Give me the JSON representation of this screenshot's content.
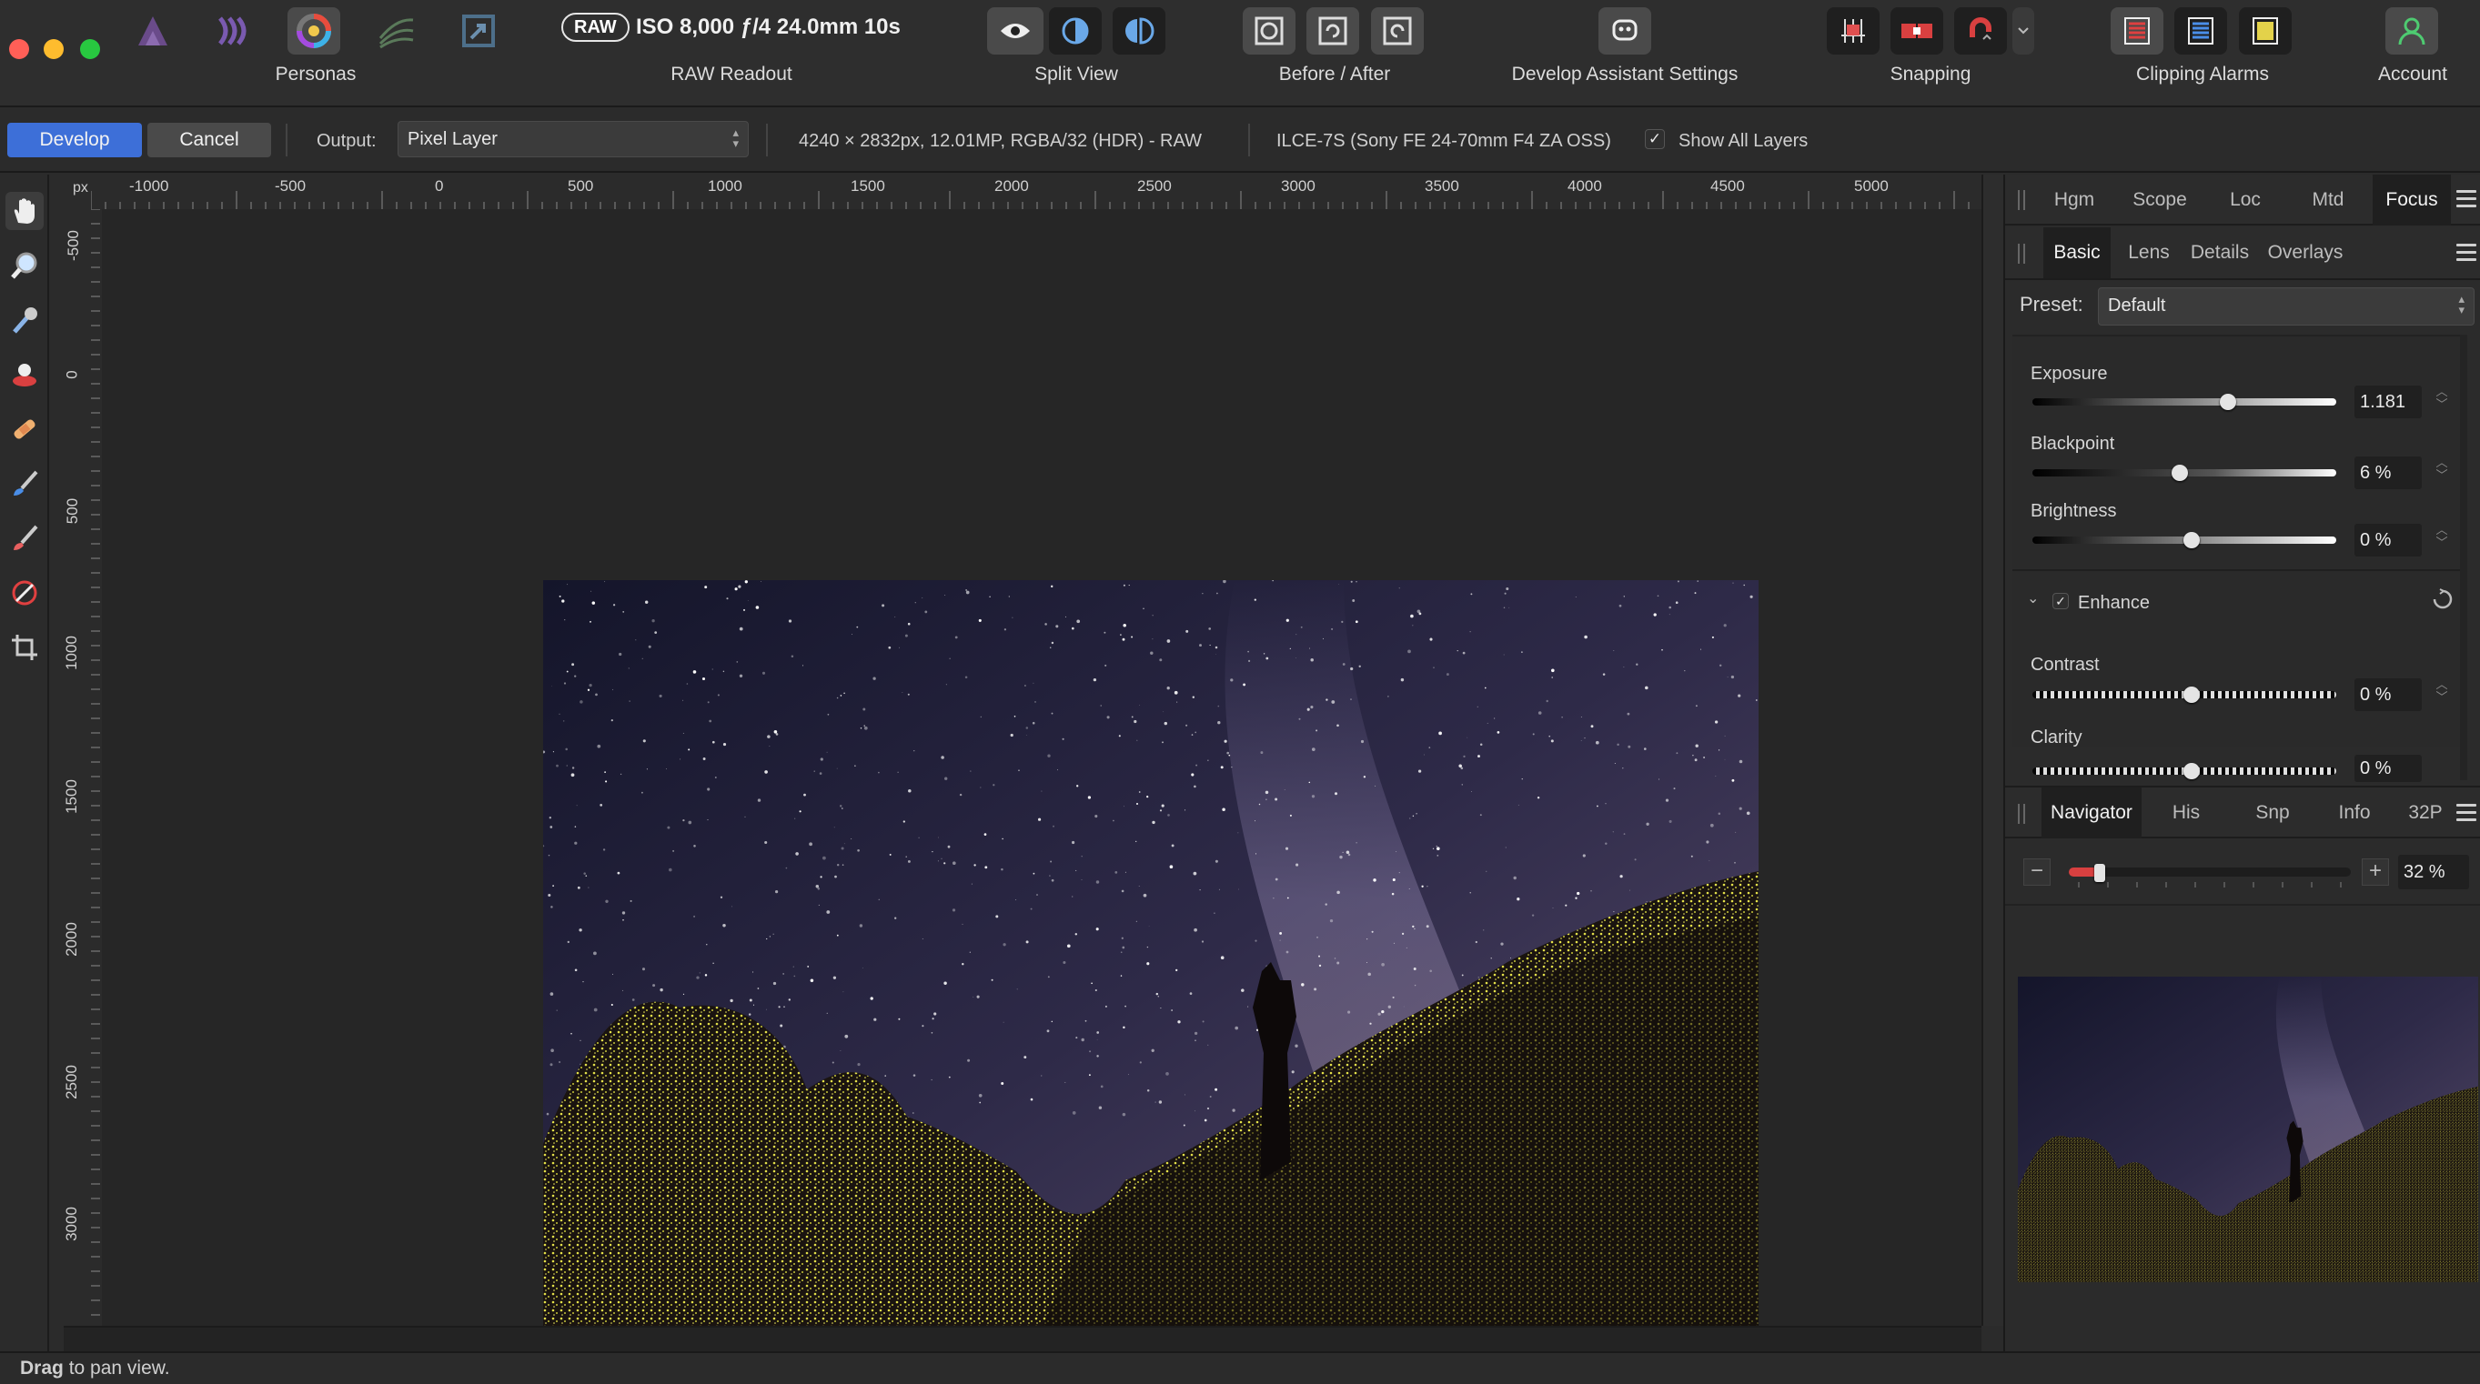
{
  "toolbar": {
    "personas_label": "Personas",
    "raw_badge": "RAW",
    "raw_info": "ISO 8,000 ƒ/4 24.0mm 10s",
    "raw_readout_label": "RAW Readout",
    "split_view_label": "Split View",
    "before_after_label": "Before / After",
    "develop_assistant_label": "Develop Assistant Settings",
    "snapping_label": "Snapping",
    "clipping_alarms_label": "Clipping Alarms",
    "account_label": "Account"
  },
  "context": {
    "develop_label": "Develop",
    "cancel_label": "Cancel",
    "output_label": "Output:",
    "output_value": "Pixel Layer",
    "image_info": "4240 × 2832px, 12.01MP, RGBA/32 (HDR) - RAW",
    "camera_info": "ILCE-7S (Sony FE 24-70mm F4 ZA OSS)",
    "show_all_layers_label": "Show All Layers",
    "show_all_layers_checked": true
  },
  "ruler": {
    "unit": "px",
    "top_ticks": [
      "-1000",
      "-500",
      "0",
      "500",
      "1000",
      "1500",
      "2000",
      "2500",
      "3000",
      "3500",
      "4000",
      "4500",
      "5000"
    ],
    "left_ticks": [
      "-500",
      "0",
      "500",
      "1000",
      "1500",
      "2000",
      "2500",
      "3000"
    ]
  },
  "panel_tabs_top": [
    "Hgm",
    "Scope",
    "Loc",
    "Mtd",
    "Focus"
  ],
  "panel_tabs_top_active": "Focus",
  "develop_tabs": [
    "Basic",
    "Lens",
    "Details",
    "Overlays"
  ],
  "develop_tabs_active": "Basic",
  "preset": {
    "label": "Preset:",
    "value": "Default"
  },
  "adjustments": {
    "exposure": {
      "label": "Exposure",
      "value": "1.181",
      "level": 0.62
    },
    "blackpoint": {
      "label": "Blackpoint",
      "value": "6 %",
      "level": 0.46
    },
    "brightness": {
      "label": "Brightness",
      "value": "0 %",
      "level": 0.5
    },
    "enhance": {
      "label": "Enhance",
      "checked": true
    },
    "contrast": {
      "label": "Contrast",
      "value": "0 %",
      "level": 0.5
    },
    "clarity": {
      "label": "Clarity",
      "value": "0 %",
      "level": 0.5
    }
  },
  "navigator_tabs": [
    "Navigator",
    "His",
    "Snp",
    "Info",
    "32P"
  ],
  "navigator_tabs_active": "Navigator",
  "navigator": {
    "zoom": "32 %",
    "zoom_level": 0.11
  },
  "status": {
    "bold": "Drag",
    "text": " to pan view."
  },
  "colors": {
    "accent": "#3d6fd8",
    "alarm_yellow": "#e3e04a",
    "sky": "#2a2741"
  }
}
